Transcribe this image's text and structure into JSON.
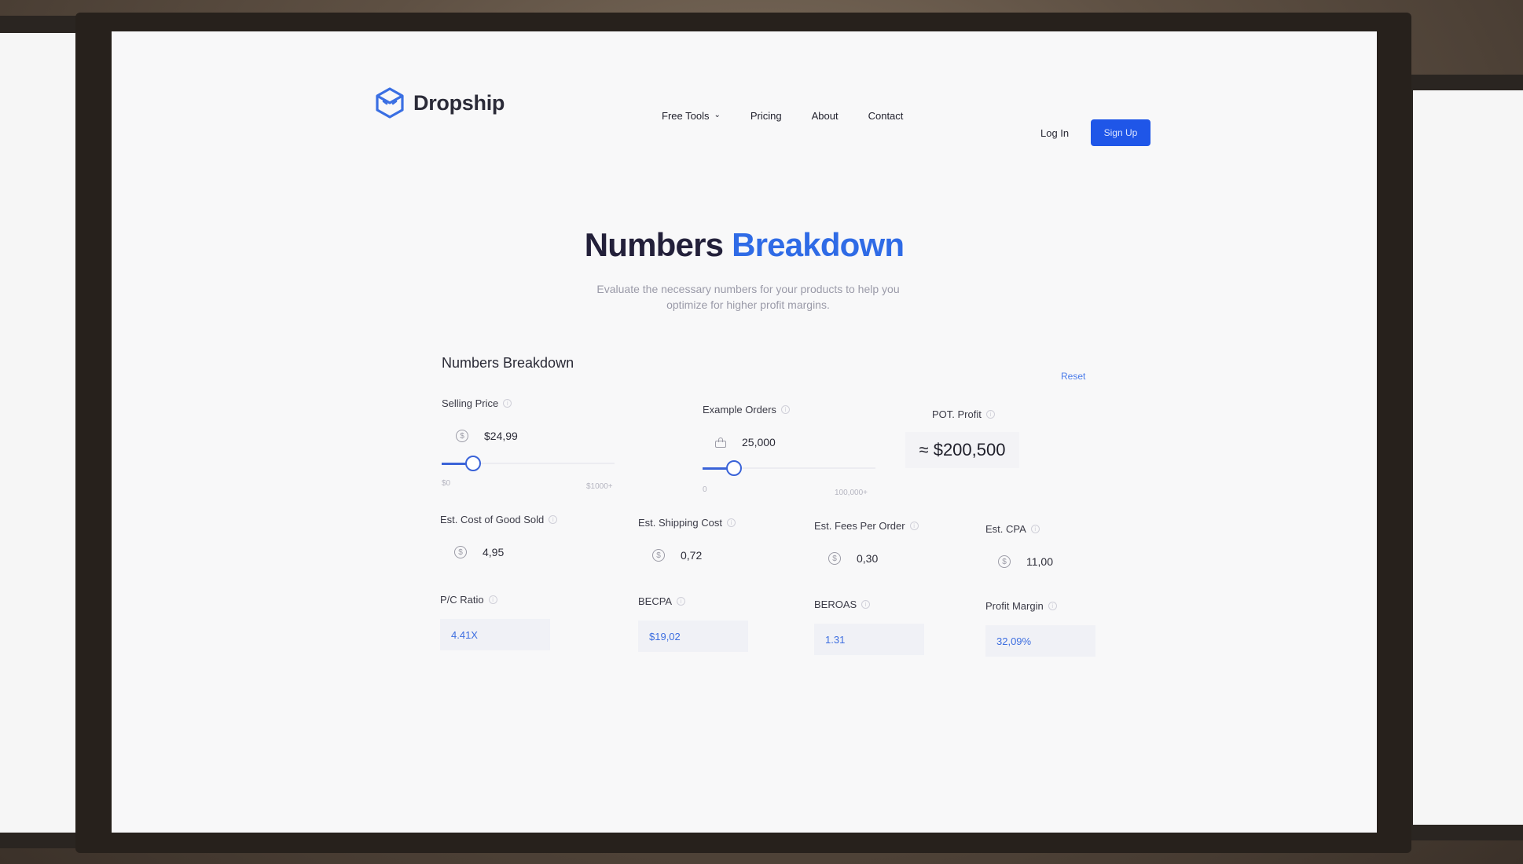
{
  "brand": {
    "name": "Dropship"
  },
  "nav": {
    "items": [
      "Free Tools",
      "Pricing",
      "About",
      "Contact"
    ],
    "login": "Log In",
    "signup": "Sign Up"
  },
  "hero": {
    "title_part1": "Numbers",
    "title_part2": "Breakdown",
    "subtitle": "Evaluate the necessary numbers for your products to help you optimize for higher profit margins."
  },
  "calculator": {
    "title": "Numbers Breakdown",
    "reset": "Reset",
    "selling_price": {
      "label": "Selling Price",
      "value": "$24,99",
      "slider_min": "$0",
      "slider_max": "$1000+",
      "slider_fraction": 0.18
    },
    "example_orders": {
      "label": "Example Orders",
      "value": "25,000",
      "slider_min": "0",
      "slider_max": "100,000+",
      "slider_fraction": 0.18
    },
    "pot_profit": {
      "label": "POT. Profit",
      "value": "≈ $200,500"
    },
    "cost_good_sold": {
      "label": "Est. Cost of Good Sold",
      "value": "4,95"
    },
    "shipping_cost": {
      "label": "Est. Shipping Cost",
      "value": "0,72"
    },
    "fees_per_order": {
      "label": "Est. Fees Per Order",
      "value": "0,30"
    },
    "cpa": {
      "label": "Est. CPA",
      "value": "11,00"
    },
    "pc_ratio": {
      "label": "P/C Ratio",
      "value": "4.41X"
    },
    "becpa": {
      "label": "BECPA",
      "value": "$19,02"
    },
    "beroas": {
      "label": "BEROAS",
      "value": "1.31"
    },
    "profit_margin": {
      "label": "Profit Margin",
      "value": "32,09%"
    }
  },
  "colors": {
    "accent": "#2f6be6",
    "button": "#1f56e8",
    "slider": "#3a63d8"
  },
  "icons": [
    "dropship-logo-icon",
    "chevron-down-icon",
    "dollar-coin-icon",
    "shopping-bag-icon",
    "info-icon"
  ]
}
